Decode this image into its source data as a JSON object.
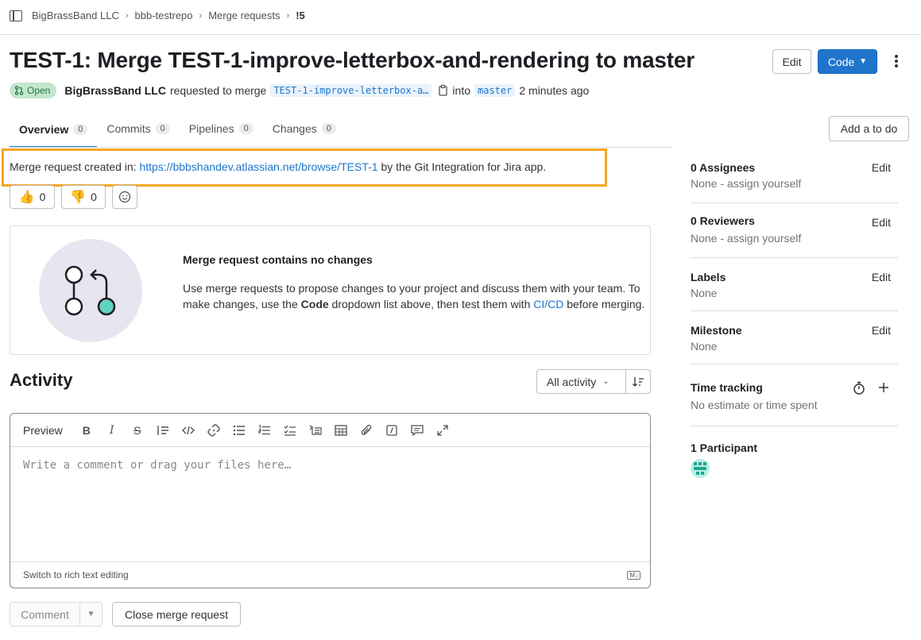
{
  "breadcrumbs": [
    "BigBrassBand LLC",
    "bbb-testrepo",
    "Merge requests",
    "!5"
  ],
  "title": "TEST-1: Merge TEST-1-improve-letterbox-and-rendering to master",
  "header_buttons": {
    "edit": "Edit",
    "code": "Code"
  },
  "meta": {
    "status": "Open",
    "author": "BigBrassBand LLC",
    "requested_text": "requested to merge",
    "source_branch": "TEST-1-improve-letterbox-a…",
    "into_text": "into",
    "target_branch": "master",
    "time": "2 minutes ago"
  },
  "tabs": [
    {
      "label": "Overview",
      "count": "0"
    },
    {
      "label": "Commits",
      "count": "0"
    },
    {
      "label": "Pipelines",
      "count": "0"
    },
    {
      "label": "Changes",
      "count": "0"
    }
  ],
  "add_todo": "Add a to do",
  "description": {
    "prefix": "Merge request created in: ",
    "link": "https://bbbshandev.atlassian.net/browse/TEST-1",
    "suffix": " by the Git Integration for Jira app."
  },
  "reactions": {
    "thumbs_up": "0",
    "thumbs_down": "0"
  },
  "empty_state": {
    "title": "Merge request contains no changes",
    "text_1": "Use merge requests to propose changes to your project and discuss them with your team. To make changes, use the ",
    "code_word": "Code",
    "text_2": " dropdown list above, then test them with ",
    "cicd_link": "CI/CD",
    "text_3": " before merging."
  },
  "activity": {
    "title": "Activity",
    "filter": "All activity"
  },
  "editor": {
    "preview": "Preview",
    "placeholder": "Write a comment or drag your files here…",
    "switch_text": "Switch to rich text editing"
  },
  "actions": {
    "comment": "Comment",
    "close": "Close merge request"
  },
  "sidebar": {
    "edit_label": "Edit",
    "assignees": {
      "title": "0 Assignees",
      "value": "None - assign yourself"
    },
    "reviewers": {
      "title": "0 Reviewers",
      "value": "None - assign yourself"
    },
    "labels": {
      "title": "Labels",
      "value": "None"
    },
    "milestone": {
      "title": "Milestone",
      "value": "None"
    },
    "time_tracking": {
      "title": "Time tracking",
      "value": "No estimate or time spent"
    },
    "participants": {
      "title": "1 Participant"
    }
  },
  "colors": {
    "accent": "#1f75cb",
    "highlight": "#f5a623",
    "open_badge": "#c3e6cd"
  }
}
